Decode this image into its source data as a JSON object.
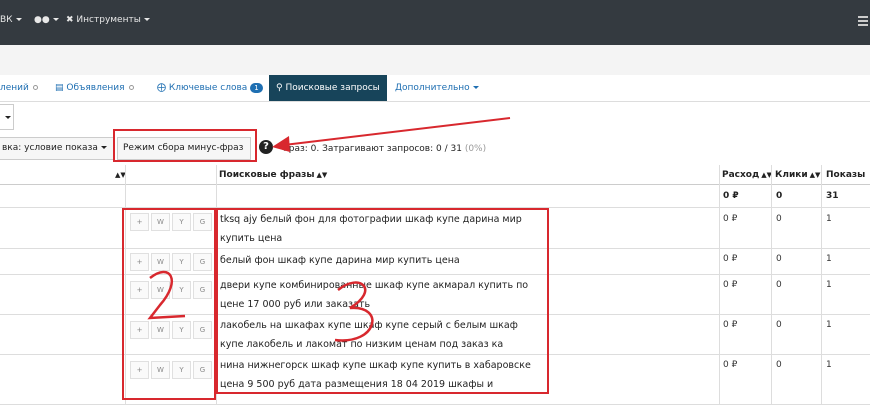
{
  "topnav": {
    "vk_label": "ВК",
    "tools_label": "Инструменты"
  },
  "tabs": [
    {
      "label": "лений",
      "active": false
    },
    {
      "label": "Объявления",
      "active": false
    },
    {
      "label": "Ключевые слова",
      "active": false,
      "badge": "1"
    },
    {
      "label": "Поисковые запросы",
      "active": true
    },
    {
      "label": "Дополнительно",
      "active": false
    }
  ],
  "filters": {
    "condition_select": "вка: условие показа",
    "minus_mode_button": "Режим сбора минус-фраз",
    "help_icon": "?",
    "stats_text": "Фраз: 0. Затрагивают запросов: 0 / 31",
    "stats_pct": "(0%)"
  },
  "table": {
    "headers": {
      "phrases": "Поисковые фразы",
      "expense": "Расход",
      "clicks": "Клики",
      "shows": "Показы"
    },
    "totals": {
      "expense": "0 ₽",
      "clicks": "0",
      "shows": "31"
    },
    "row_buttons": [
      "+",
      "W",
      "Y",
      "G"
    ],
    "rows": [
      {
        "phrase": "tksq ajy белый фон для фотографии шкаф купе дарина мир купить цена",
        "expense": "0 ₽",
        "clicks": "0",
        "shows": "1"
      },
      {
        "phrase": "белый фон шкаф купе дарина мир купить цена",
        "expense": "0 ₽",
        "clicks": "0",
        "shows": "1"
      },
      {
        "phrase": "двери купе комбинированные шкаф купе акмарал купить по цене 17 000 руб или заказать",
        "expense": "0 ₽",
        "clicks": "0",
        "shows": "1"
      },
      {
        "phrase": "лакобель на шкафах купе шкаф купе серый с белым шкаф купе лакобель и лакомат по низким ценам под заказ ка",
        "expense": "0 ₽",
        "clicks": "0",
        "shows": "1"
      },
      {
        "phrase": "нина нижнегорск шкаф купе шкаф купе купить в хабаровске цена 9 500 руб дата размещения 18 04 2019 шкафы и",
        "expense": "0 ₽",
        "clicks": "0",
        "shows": "1"
      }
    ]
  },
  "colors": {
    "topbar": "#343a40",
    "active_tab": "#17445a",
    "link": "#1f6fb2",
    "annotation": "#d8282e"
  }
}
